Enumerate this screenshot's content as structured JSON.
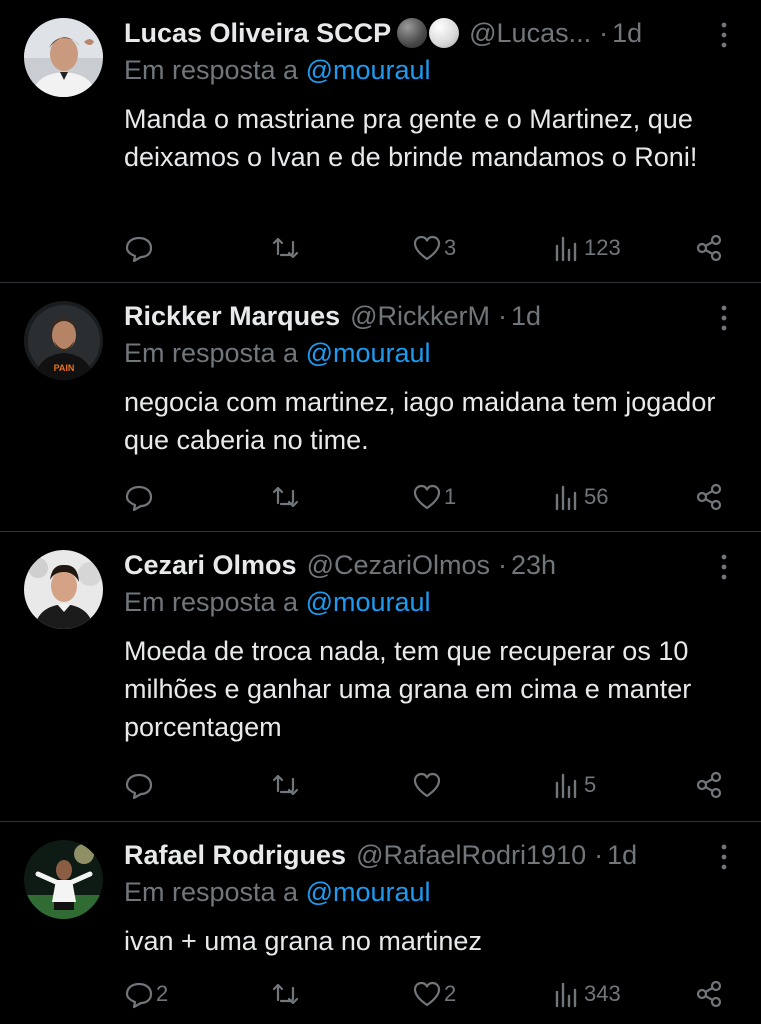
{
  "reply_prefix": "Em resposta a",
  "colors": {
    "background": "#000000",
    "text": "#e7e9ea",
    "secondary": "#71767b",
    "accent": "#1d9bf0",
    "divider": "#2f3336"
  },
  "tweets": [
    {
      "display_name": "Lucas Oliveira SCCP",
      "handle": "@Lucas...",
      "time": "1d",
      "reply_to": "@mouraul",
      "text": "Manda o mastriane pra gente e o Martinez, que deixamos o Ivan e de brinde mandamos o Roni!",
      "replies": "",
      "retweets": "",
      "likes": "3",
      "views": "123"
    },
    {
      "display_name": "Rickker Marques",
      "handle": "@RickkerM",
      "time": "1d",
      "reply_to": "@mouraul",
      "text": "negocia com martinez, iago maidana tem jogador que caberia no time.",
      "replies": "",
      "retweets": "",
      "likes": "1",
      "views": "56"
    },
    {
      "display_name": "Cezari Olmos",
      "handle": "@CezariOlmos",
      "time": "23h",
      "reply_to": "@mouraul",
      "text": "Moeda de troca nada, tem que recuperar os 10 milhões e ganhar uma grana em cima e manter porcentagem",
      "replies": "",
      "retweets": "",
      "likes": "",
      "views": "5"
    },
    {
      "display_name": "Rafael Rodrigues",
      "handle": "@RafaelRodri1910",
      "time": "1d",
      "reply_to": "@mouraul",
      "text": "ivan + uma grana no martinez",
      "replies": "2",
      "retweets": "",
      "likes": "2",
      "views": "343"
    }
  ]
}
